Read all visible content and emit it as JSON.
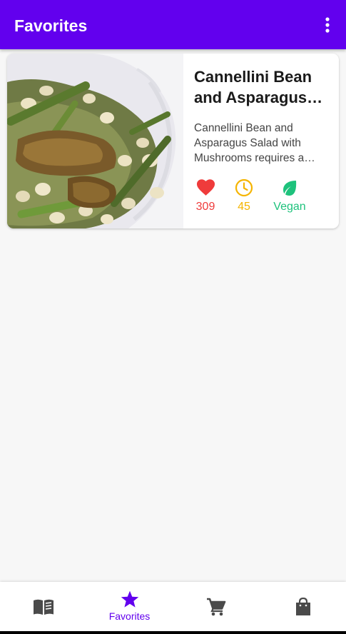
{
  "app_bar": {
    "title": "Favorites",
    "menu_icon": "more-vert-icon"
  },
  "colors": {
    "primary": "#6200ee",
    "likes": "#ef3b3b",
    "time": "#f5b400",
    "vegan": "#1ec27c"
  },
  "recipes": [
    {
      "title": "Cannellini Bean and Asparagus…",
      "description": "Cannellini Bean and Asparagus Salad with Mushrooms requires a…",
      "likes": "309",
      "minutes": "45",
      "diet": "Vegan",
      "image_icon": "recipe-photo"
    }
  ],
  "bottom_nav": [
    {
      "icon": "menu-book-icon",
      "label": ""
    },
    {
      "icon": "star-icon",
      "label": "Favorites",
      "selected": true
    },
    {
      "icon": "cart-icon",
      "label": ""
    },
    {
      "icon": "shopping-bag-icon",
      "label": ""
    }
  ]
}
